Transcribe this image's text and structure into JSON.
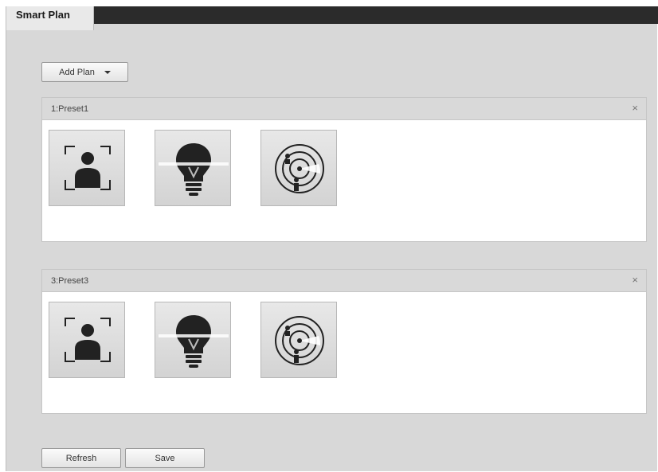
{
  "tab": {
    "title": "Smart Plan"
  },
  "toolbar": {
    "add_plan_label": "Add Plan"
  },
  "sections": [
    {
      "title": "1:Preset1",
      "close_symbol": "×",
      "icons": [
        "face-detection-icon",
        "light-bulb-icon",
        "radar-tracking-icon"
      ]
    },
    {
      "title": "3:Preset3",
      "close_symbol": "×",
      "icons": [
        "face-detection-icon",
        "light-bulb-icon",
        "radar-tracking-icon"
      ]
    }
  ],
  "footer": {
    "refresh_label": "Refresh",
    "save_label": "Save"
  },
  "colors": {
    "tab_bar": "#2b2b2b",
    "panel_bg": "#d8d8d8",
    "section_header": "#d9d9d9"
  }
}
